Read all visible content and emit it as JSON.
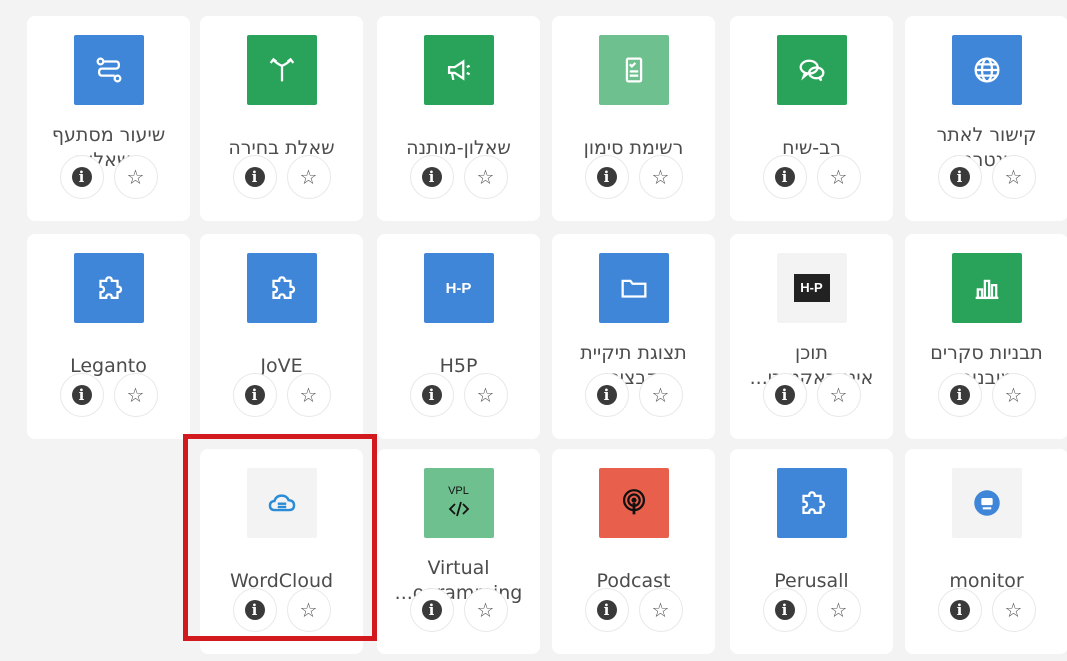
{
  "colors": {
    "blue": "#3f86d8",
    "green": "#29a35a",
    "light_green": "#6fc08f",
    "red": "#e8604c",
    "dark": "#222222",
    "highlight": "#d2191e"
  },
  "tiles": [
    {
      "name": "url",
      "label": "קישור לאתר\nאינטרנט",
      "icon": "globe-icon"
    },
    {
      "name": "forum",
      "label": "רב-שיח",
      "icon": "chat-bubbles-icon"
    },
    {
      "name": "checklist",
      "label": "רשימת סימון",
      "icon": "checklist-icon"
    },
    {
      "name": "feedback",
      "label": "שאלון-מותנה",
      "icon": "megaphone-icon"
    },
    {
      "name": "choice",
      "label": "שאלת בחירה",
      "icon": "signpost-icon"
    },
    {
      "name": "lesson",
      "label": "שיעור מסתעף\nבשאלות",
      "icon": "branch-icon"
    },
    {
      "name": "survey",
      "label": "תבניות סקרים\nמובנות",
      "icon": "bar-chart-icon"
    },
    {
      "name": "interactive-content",
      "label": "תוכן\nאינטראקטיבי...",
      "icon": "h5p-icon"
    },
    {
      "name": "folder",
      "label": "תצוגת תיקיית\nקבצים",
      "icon": "folder-icon"
    },
    {
      "name": "h5p",
      "label": "H5P",
      "icon": "h5p-icon"
    },
    {
      "name": "jove",
      "label": "JoVE",
      "icon": "puzzle-icon"
    },
    {
      "name": "leganto",
      "label": "Leganto",
      "icon": "puzzle-icon"
    },
    {
      "name": "monitor",
      "label": "monitor",
      "icon": "monitor-badge-icon"
    },
    {
      "name": "perusall",
      "label": "Perusall",
      "icon": "puzzle-icon"
    },
    {
      "name": "podcast",
      "label": "Podcast",
      "icon": "podcast-icon"
    },
    {
      "name": "vpl",
      "label": "Virtual\n...ogramming",
      "icon": "code-icon",
      "icon_text": "VPL"
    },
    {
      "name": "wordcloud",
      "label": "WordCloud",
      "icon": "cloud-icon"
    }
  ],
  "info_glyph": "i",
  "star_glyph": "☆"
}
